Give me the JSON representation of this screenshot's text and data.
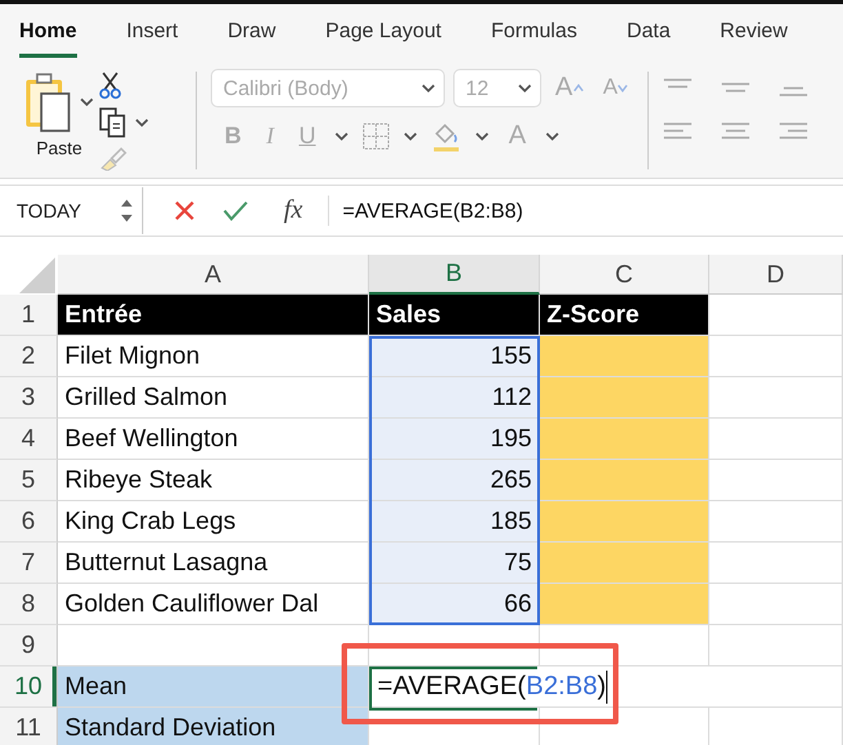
{
  "tabs": [
    {
      "label": "Home",
      "selected": true
    },
    {
      "label": "Insert",
      "selected": false
    },
    {
      "label": "Draw",
      "selected": false
    },
    {
      "label": "Page Layout",
      "selected": false
    },
    {
      "label": "Formulas",
      "selected": false
    },
    {
      "label": "Data",
      "selected": false
    },
    {
      "label": "Review",
      "selected": false
    }
  ],
  "ribbon": {
    "disabled": true,
    "paste_label": "Paste",
    "font": "Calibri (Body)",
    "font_size": "12",
    "grow_glyph": "A",
    "shrink_glyph": "A",
    "bold": "B",
    "italic": "I",
    "underline": "U",
    "font_color_glyph": "A"
  },
  "formula_bar": {
    "name_box": "TODAY",
    "function_label": "fx",
    "formula": "=AVERAGE(B2:B8)"
  },
  "columns": [
    {
      "label": "A",
      "selected": false
    },
    {
      "label": "B",
      "selected": true
    },
    {
      "label": "C",
      "selected": false
    },
    {
      "label": "D",
      "selected": false
    }
  ],
  "rows": [
    {
      "number": "1",
      "selected": false,
      "kind": "header",
      "cells": [
        {
          "text": "Entrée",
          "color": "#000000"
        },
        {
          "text": "Sales",
          "color": "#000000"
        },
        {
          "text": "Z-Score",
          "color": "#000000"
        },
        {}
      ]
    },
    {
      "number": "2",
      "selected": false,
      "kind": "data",
      "cells": [
        {
          "text": "Filet Mignon"
        },
        {
          "text": "155",
          "kind": "number",
          "in_range": true
        },
        {
          "color": "#fdd663"
        },
        {}
      ]
    },
    {
      "number": "3",
      "selected": false,
      "kind": "data",
      "cells": [
        {
          "text": "Grilled Salmon"
        },
        {
          "text": "112",
          "kind": "number",
          "in_range": true
        },
        {
          "color": "#fdd663"
        },
        {}
      ]
    },
    {
      "number": "4",
      "selected": false,
      "kind": "data",
      "cells": [
        {
          "text": "Beef Wellington"
        },
        {
          "text": "195",
          "kind": "number",
          "in_range": true
        },
        {
          "color": "#fdd663"
        },
        {}
      ]
    },
    {
      "number": "5",
      "selected": false,
      "kind": "data",
      "cells": [
        {
          "text": "Ribeye Steak"
        },
        {
          "text": "265",
          "kind": "number",
          "in_range": true
        },
        {
          "color": "#fdd663"
        },
        {}
      ]
    },
    {
      "number": "6",
      "selected": false,
      "kind": "data",
      "cells": [
        {
          "text": "King Crab Legs"
        },
        {
          "text": "185",
          "kind": "number",
          "in_range": true
        },
        {
          "color": "#fdd663"
        },
        {}
      ]
    },
    {
      "number": "7",
      "selected": false,
      "kind": "data",
      "cells": [
        {
          "text": "Butternut Lasagna"
        },
        {
          "text": "75",
          "kind": "number",
          "in_range": true
        },
        {
          "color": "#fdd663"
        },
        {}
      ]
    },
    {
      "number": "8",
      "selected": false,
      "kind": "data",
      "cells": [
        {
          "text": "Golden Cauliflower Dal"
        },
        {
          "text": "66",
          "kind": "number",
          "in_range": true
        },
        {
          "color": "#fdd663"
        },
        {}
      ]
    },
    {
      "number": "9",
      "selected": false,
      "kind": "data",
      "cells": [
        {},
        {},
        {},
        {}
      ]
    },
    {
      "number": "10",
      "selected": true,
      "kind": "data",
      "cells": [
        {
          "text": "Mean",
          "color": "#bdd7ee"
        },
        {
          "editing": true,
          "highlighted": true,
          "formula": [
            {
              "text": "=AVERAGE(",
              "kind": "plain"
            },
            {
              "text": "B2:B8",
              "kind": "ref"
            },
            {
              "text": ")",
              "kind": "plain"
            }
          ]
        },
        {},
        {}
      ]
    },
    {
      "number": "11",
      "selected": false,
      "kind": "data",
      "cells": [
        {
          "text": "Standard Deviation",
          "color": "#bdd7ee"
        },
        {},
        {},
        {}
      ]
    }
  ]
}
